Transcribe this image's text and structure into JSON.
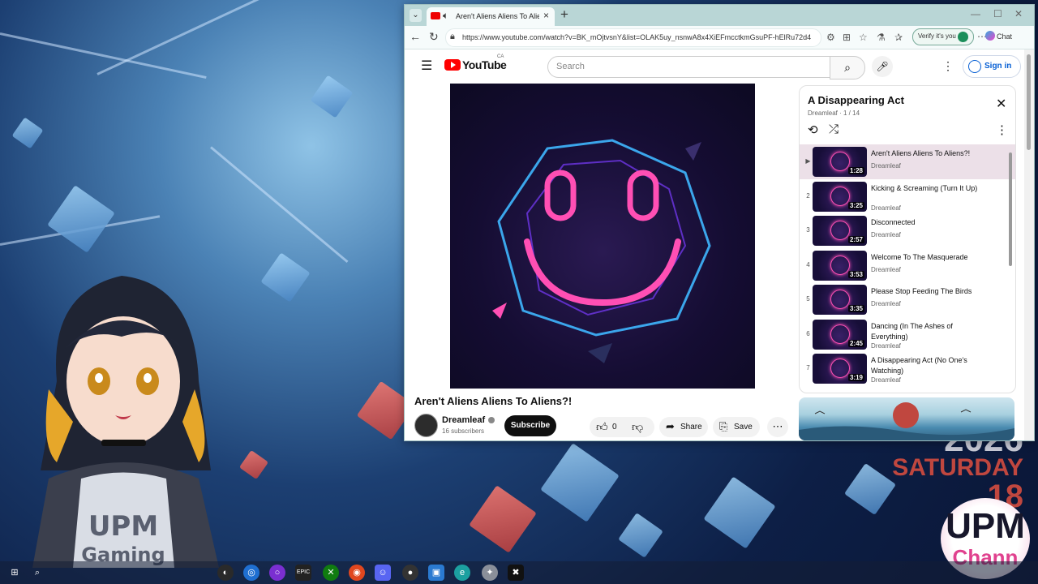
{
  "browser": {
    "tab_title": "Aren't Aliens Aliens To Aliens?!",
    "url": "https://www.youtube.com/watch?v=BK_mOjtvsnY&list=OLAK5uy_nsnwA8x4XiEFmcctkmGsuPF-hElRu72d4",
    "verify_label": "Verify it's you",
    "chat_label": "Chat"
  },
  "youtube": {
    "logo_text": "YouTube",
    "region": "CA",
    "search_placeholder": "Search",
    "signin_label": "Sign in",
    "video_title": "Aren't Aliens Aliens To Aliens?!",
    "channel_name": "Dreamleaf",
    "subscribers": "16 subscribers",
    "subscribe_label": "Subscribe",
    "like_count": "0",
    "share_label": "Share",
    "save_label": "Save"
  },
  "playlist": {
    "title": "A Disappearing Act",
    "meta": "Dreamleaf · 1 / 14",
    "items": [
      {
        "index": "▶",
        "title": "Aren't Aliens Aliens To Aliens?!",
        "channel": "Dreamleaf",
        "duration": "1:28",
        "active": true
      },
      {
        "index": "2",
        "title": "Kicking & Screaming (Turn It Up)",
        "channel": "Dreamleaf",
        "duration": "3:25"
      },
      {
        "index": "3",
        "title": "Disconnected",
        "channel": "Dreamleaf",
        "duration": "2:57"
      },
      {
        "index": "4",
        "title": "Welcome To The Masquerade",
        "channel": "Dreamleaf",
        "duration": "3:53"
      },
      {
        "index": "5",
        "title": "Please Stop Feeding The Birds",
        "channel": "Dreamleaf",
        "duration": "3:35"
      },
      {
        "index": "6",
        "title": "Dancing (In The Ashes of Everything)",
        "channel": "Dreamleaf",
        "duration": "2:45"
      },
      {
        "index": "7",
        "title": "A Disappearing Act (No One's Watching)",
        "channel": "Dreamleaf",
        "duration": "3:19"
      }
    ]
  },
  "desktop": {
    "year": "2026",
    "weekday": "SATURDAY",
    "day": "18",
    "avatar_shirt_text": "UPM Gaming",
    "logo_line1": "UPM",
    "logo_line2": "Chann"
  },
  "colors": {
    "youtube_red": "#ff0000",
    "link_blue": "#065fd4",
    "neon_pink": "#ff4fb4",
    "neon_blue": "#3fb7ff"
  }
}
